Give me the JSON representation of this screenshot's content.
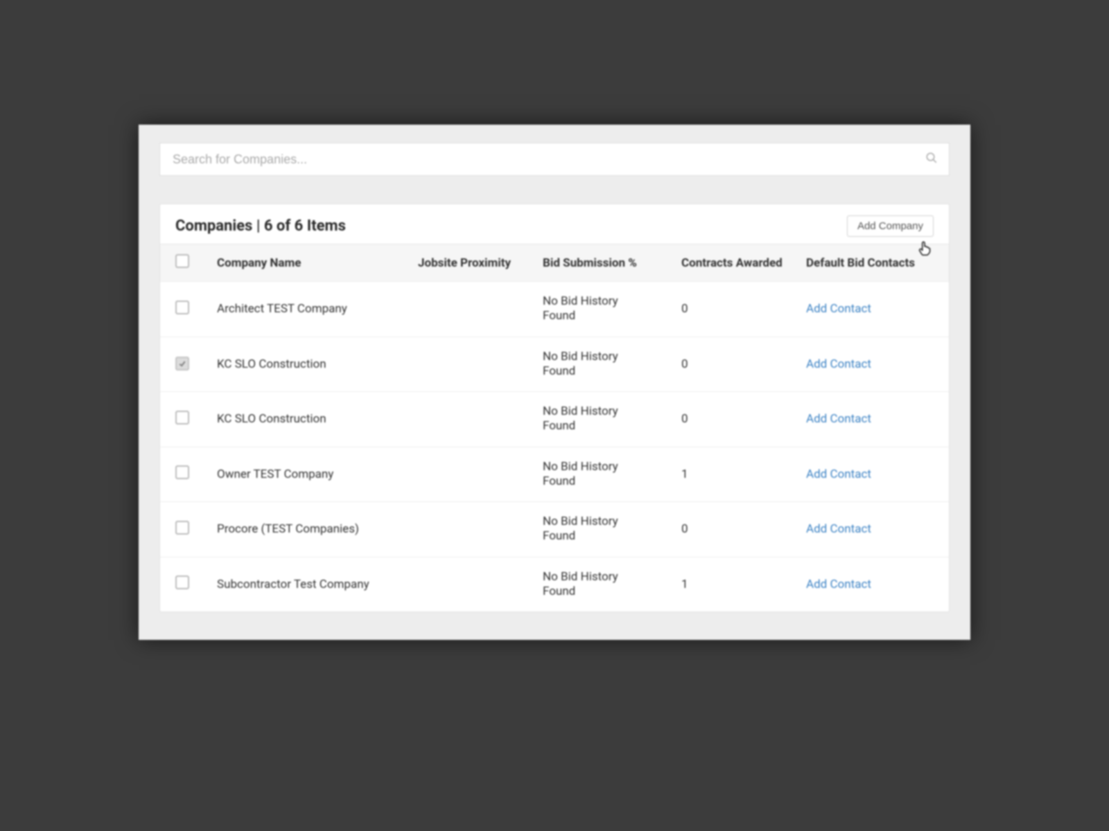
{
  "search": {
    "placeholder": "Search for Companies..."
  },
  "card": {
    "title": "Companies | 6 of 6 Items",
    "add_button": "Add Company"
  },
  "columns": {
    "name": "Company Name",
    "proximity": "Jobsite Proximity",
    "bid": "Bid Submission %",
    "contracts": "Contracts Awarded",
    "contacts": "Default Bid Contacts"
  },
  "rows": [
    {
      "checked": false,
      "name": "Architect TEST Company",
      "proximity": "",
      "bid": "No Bid History Found",
      "contracts": "0",
      "contact_action": "Add Contact"
    },
    {
      "checked": true,
      "name": "KC SLO Construction",
      "proximity": "",
      "bid": "No Bid History Found",
      "contracts": "0",
      "contact_action": "Add Contact"
    },
    {
      "checked": false,
      "name": "KC SLO Construction",
      "proximity": "",
      "bid": "No Bid History Found",
      "contracts": "0",
      "contact_action": "Add Contact"
    },
    {
      "checked": false,
      "name": "Owner TEST Company",
      "proximity": "",
      "bid": "No Bid History Found",
      "contracts": "1",
      "contact_action": "Add Contact"
    },
    {
      "checked": false,
      "name": "Procore (TEST Companies)",
      "proximity": "",
      "bid": "No Bid History Found",
      "contracts": "0",
      "contact_action": "Add Contact"
    },
    {
      "checked": false,
      "name": "Subcontractor Test Company",
      "proximity": "",
      "bid": "No Bid History Found",
      "contracts": "1",
      "contact_action": "Add Contact"
    }
  ],
  "colors": {
    "link": "#3b82c4"
  }
}
